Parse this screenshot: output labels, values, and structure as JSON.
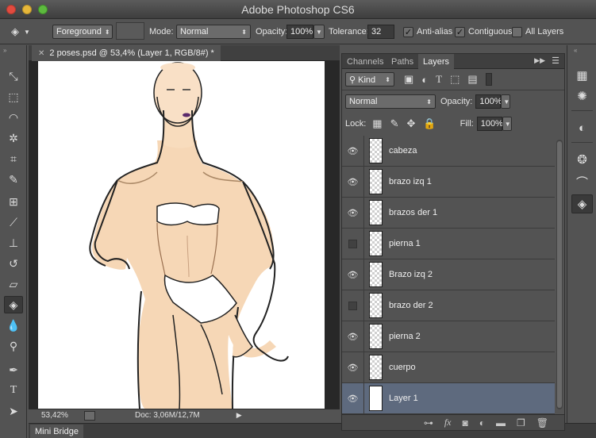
{
  "app": {
    "title": "Adobe Photoshop CS6"
  },
  "options_bar": {
    "fill_source": "Foreground",
    "mode_label": "Mode:",
    "mode_value": "Normal",
    "opacity_label": "Opacity:",
    "opacity_value": "100%",
    "tolerance_label": "Tolerance:",
    "tolerance_value": "32",
    "antialias_label": "Anti-alias",
    "contiguous_label": "Contiguous",
    "alllayers_label": "All Layers"
  },
  "document": {
    "tab_title": "2 poses.psd @ 53,4% (Layer 1, RGB/8#) *"
  },
  "status": {
    "zoom": "53,42%",
    "doc_size": "Doc: 3,06M/12,7M"
  },
  "mini_bridge": {
    "label": "Mini Bridge"
  },
  "panel": {
    "tabs": [
      "Channels",
      "Paths",
      "Layers"
    ],
    "kind_label": "Kind",
    "blend_mode": "Normal",
    "opacity_label": "Opacity:",
    "opacity_value": "100%",
    "lock_label": "Lock:",
    "fill_label": "Fill:",
    "fill_value": "100%",
    "layers": [
      {
        "name": "cabeza",
        "visible": true
      },
      {
        "name": "brazo izq 1",
        "visible": true
      },
      {
        "name": "brazos der 1",
        "visible": true
      },
      {
        "name": "pierna 1",
        "visible": false
      },
      {
        "name": "Brazo izq 2",
        "visible": true
      },
      {
        "name": "brazo der 2",
        "visible": false
      },
      {
        "name": "pierna 2",
        "visible": true
      },
      {
        "name": "cuerpo",
        "visible": true
      },
      {
        "name": "Layer 1",
        "visible": true,
        "selected": true
      }
    ],
    "bottom_icons": [
      "link-icon",
      "fx-icon",
      "mask-icon",
      "adjustment-icon",
      "folder-icon",
      "new-layer-icon",
      "trash-icon"
    ]
  },
  "colors": {
    "ui_bg": "#535353",
    "selected_layer": "#5e6a7e",
    "skin": "#f6d7b6"
  }
}
